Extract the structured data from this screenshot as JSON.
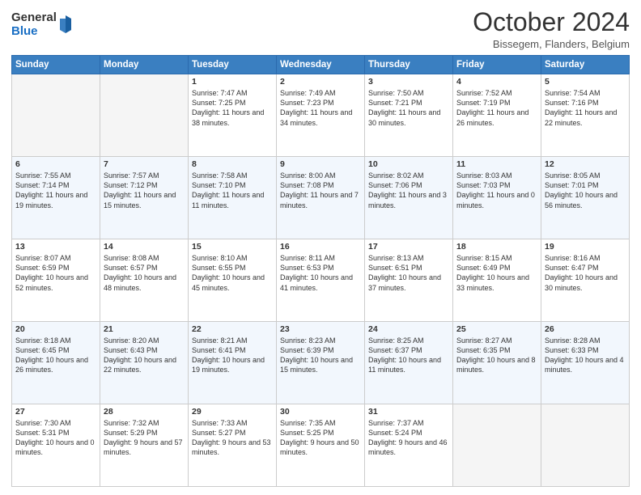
{
  "logo": {
    "general": "General",
    "blue": "Blue"
  },
  "header": {
    "month": "October 2024",
    "location": "Bissegem, Flanders, Belgium"
  },
  "days_of_week": [
    "Sunday",
    "Monday",
    "Tuesday",
    "Wednesday",
    "Thursday",
    "Friday",
    "Saturday"
  ],
  "weeks": [
    [
      {
        "day": "",
        "info": ""
      },
      {
        "day": "",
        "info": ""
      },
      {
        "day": "1",
        "info": "Sunrise: 7:47 AM\nSunset: 7:25 PM\nDaylight: 11 hours and 38 minutes."
      },
      {
        "day": "2",
        "info": "Sunrise: 7:49 AM\nSunset: 7:23 PM\nDaylight: 11 hours and 34 minutes."
      },
      {
        "day": "3",
        "info": "Sunrise: 7:50 AM\nSunset: 7:21 PM\nDaylight: 11 hours and 30 minutes."
      },
      {
        "day": "4",
        "info": "Sunrise: 7:52 AM\nSunset: 7:19 PM\nDaylight: 11 hours and 26 minutes."
      },
      {
        "day": "5",
        "info": "Sunrise: 7:54 AM\nSunset: 7:16 PM\nDaylight: 11 hours and 22 minutes."
      }
    ],
    [
      {
        "day": "6",
        "info": "Sunrise: 7:55 AM\nSunset: 7:14 PM\nDaylight: 11 hours and 19 minutes."
      },
      {
        "day": "7",
        "info": "Sunrise: 7:57 AM\nSunset: 7:12 PM\nDaylight: 11 hours and 15 minutes."
      },
      {
        "day": "8",
        "info": "Sunrise: 7:58 AM\nSunset: 7:10 PM\nDaylight: 11 hours and 11 minutes."
      },
      {
        "day": "9",
        "info": "Sunrise: 8:00 AM\nSunset: 7:08 PM\nDaylight: 11 hours and 7 minutes."
      },
      {
        "day": "10",
        "info": "Sunrise: 8:02 AM\nSunset: 7:06 PM\nDaylight: 11 hours and 3 minutes."
      },
      {
        "day": "11",
        "info": "Sunrise: 8:03 AM\nSunset: 7:03 PM\nDaylight: 11 hours and 0 minutes."
      },
      {
        "day": "12",
        "info": "Sunrise: 8:05 AM\nSunset: 7:01 PM\nDaylight: 10 hours and 56 minutes."
      }
    ],
    [
      {
        "day": "13",
        "info": "Sunrise: 8:07 AM\nSunset: 6:59 PM\nDaylight: 10 hours and 52 minutes."
      },
      {
        "day": "14",
        "info": "Sunrise: 8:08 AM\nSunset: 6:57 PM\nDaylight: 10 hours and 48 minutes."
      },
      {
        "day": "15",
        "info": "Sunrise: 8:10 AM\nSunset: 6:55 PM\nDaylight: 10 hours and 45 minutes."
      },
      {
        "day": "16",
        "info": "Sunrise: 8:11 AM\nSunset: 6:53 PM\nDaylight: 10 hours and 41 minutes."
      },
      {
        "day": "17",
        "info": "Sunrise: 8:13 AM\nSunset: 6:51 PM\nDaylight: 10 hours and 37 minutes."
      },
      {
        "day": "18",
        "info": "Sunrise: 8:15 AM\nSunset: 6:49 PM\nDaylight: 10 hours and 33 minutes."
      },
      {
        "day": "19",
        "info": "Sunrise: 8:16 AM\nSunset: 6:47 PM\nDaylight: 10 hours and 30 minutes."
      }
    ],
    [
      {
        "day": "20",
        "info": "Sunrise: 8:18 AM\nSunset: 6:45 PM\nDaylight: 10 hours and 26 minutes."
      },
      {
        "day": "21",
        "info": "Sunrise: 8:20 AM\nSunset: 6:43 PM\nDaylight: 10 hours and 22 minutes."
      },
      {
        "day": "22",
        "info": "Sunrise: 8:21 AM\nSunset: 6:41 PM\nDaylight: 10 hours and 19 minutes."
      },
      {
        "day": "23",
        "info": "Sunrise: 8:23 AM\nSunset: 6:39 PM\nDaylight: 10 hours and 15 minutes."
      },
      {
        "day": "24",
        "info": "Sunrise: 8:25 AM\nSunset: 6:37 PM\nDaylight: 10 hours and 11 minutes."
      },
      {
        "day": "25",
        "info": "Sunrise: 8:27 AM\nSunset: 6:35 PM\nDaylight: 10 hours and 8 minutes."
      },
      {
        "day": "26",
        "info": "Sunrise: 8:28 AM\nSunset: 6:33 PM\nDaylight: 10 hours and 4 minutes."
      }
    ],
    [
      {
        "day": "27",
        "info": "Sunrise: 7:30 AM\nSunset: 5:31 PM\nDaylight: 10 hours and 0 minutes."
      },
      {
        "day": "28",
        "info": "Sunrise: 7:32 AM\nSunset: 5:29 PM\nDaylight: 9 hours and 57 minutes."
      },
      {
        "day": "29",
        "info": "Sunrise: 7:33 AM\nSunset: 5:27 PM\nDaylight: 9 hours and 53 minutes."
      },
      {
        "day": "30",
        "info": "Sunrise: 7:35 AM\nSunset: 5:25 PM\nDaylight: 9 hours and 50 minutes."
      },
      {
        "day": "31",
        "info": "Sunrise: 7:37 AM\nSunset: 5:24 PM\nDaylight: 9 hours and 46 minutes."
      },
      {
        "day": "",
        "info": ""
      },
      {
        "day": "",
        "info": ""
      }
    ]
  ]
}
